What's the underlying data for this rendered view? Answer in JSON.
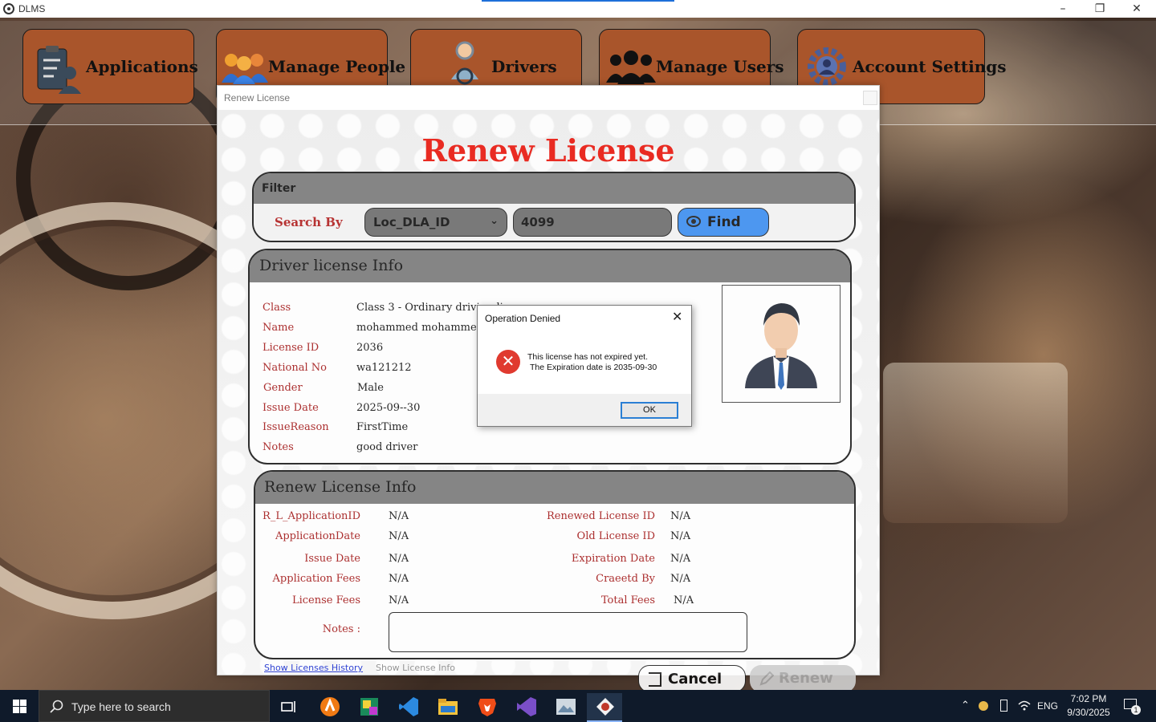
{
  "window": {
    "title": "DLMS"
  },
  "nav": {
    "applications": "Applications",
    "manage_people": "Manage People",
    "drivers": "Drivers",
    "manage_users": "Manage Users",
    "account_settings": "Account Settings"
  },
  "dialog": {
    "window_title": "Renew License",
    "heading": "Renew License",
    "filter": {
      "title": "Filter",
      "search_by_label": "Search By",
      "search_by_value": "Loc_DLA_ID",
      "search_value": "4099",
      "find_label": "Find"
    },
    "driver_info": {
      "title": "Driver license Info",
      "fields": [
        {
          "label": "Class",
          "value": "Class 3 - Ordinary driving license"
        },
        {
          "label": "Name",
          "value": "mohammed mohammed mohammed"
        },
        {
          "label": "License ID",
          "value": "2036"
        },
        {
          "label": "National No",
          "value": "wa121212"
        },
        {
          "label": "Gender",
          "value": "Male"
        },
        {
          "label": "Issue Date",
          "value": "2025-09--30"
        },
        {
          "label": "IssueReason",
          "value": "FirstTime"
        },
        {
          "label": "Notes",
          "value": "good driver"
        }
      ]
    },
    "renew_info": {
      "title": "Renew License Info",
      "left": [
        {
          "label": "R_L_ApplicationID",
          "value": "N/A"
        },
        {
          "label": "ApplicationDate",
          "value": "N/A"
        },
        {
          "label": "Issue Date",
          "value": "N/A"
        },
        {
          "label": "Application Fees",
          "value": "N/A"
        },
        {
          "label": "License Fees",
          "value": "N/A"
        }
      ],
      "right": [
        {
          "label": "Renewed License ID",
          "value": "N/A"
        },
        {
          "label": "Old License ID",
          "value": "N/A"
        },
        {
          "label": "Expiration Date",
          "value": "N/A"
        },
        {
          "label": "Craeetd By",
          "value": "N/A"
        },
        {
          "label": "Total Fees",
          "value": "N/A"
        }
      ],
      "notes_label": "Notes :",
      "notes_value": ""
    },
    "links": {
      "show_history": "Show Licenses History",
      "show_license_info": "Show License Info"
    },
    "buttons": {
      "cancel": "Cancel",
      "renew": "Renew"
    }
  },
  "message_box": {
    "title": "Operation Denied",
    "line1": "This license has not expired yet.",
    "line2": "The Expiration date is 2035-09-30",
    "ok": "OK",
    "icon": "error-icon"
  },
  "taskbar": {
    "search_placeholder": "Type here to search",
    "language": "ENG",
    "time": "7:02 PM",
    "date": "9/30/2025",
    "notification_count": "1"
  },
  "colors": {
    "nav_button": "#a9552b",
    "form_title": "#e8160c",
    "label_red": "#a41a1a",
    "find_button": "#3c8ef0",
    "panel_header": "#7a7a7a"
  }
}
